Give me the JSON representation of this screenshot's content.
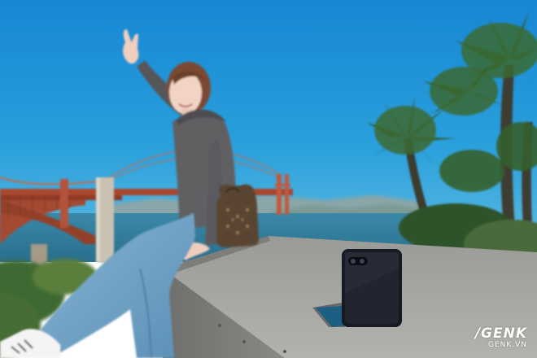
{
  "photo": {
    "subject": "woman-waving-beside-flip-phone",
    "background": "golden-gate-bridge-bay-palms",
    "device": "foldable-phone-half-open"
  },
  "watermark": {
    "brand": "/GENK",
    "domain": "GENK.VN"
  },
  "colors": {
    "sky": "#1f97d8",
    "bridge": "#b5543a",
    "wall": "#8a8a87",
    "phone": "#161a22",
    "jeans": "#6fa2c6",
    "sweater": "#5d5d60"
  }
}
